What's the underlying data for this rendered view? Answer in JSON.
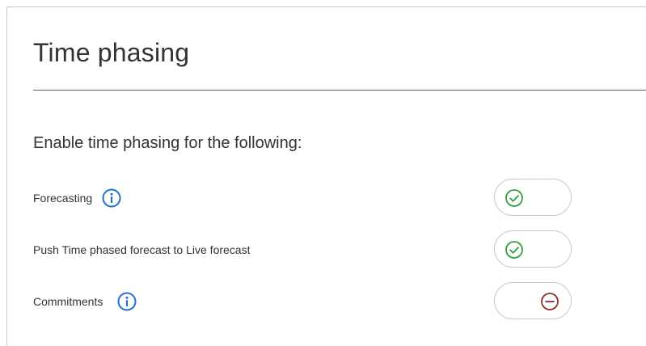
{
  "section": {
    "title": "Time phasing",
    "subtitle": "Enable time phasing for the following:"
  },
  "settings": [
    {
      "label": "Forecasting",
      "has_info": true,
      "state": "on",
      "state_icon": "check-circle-icon"
    },
    {
      "label": "Push Time phased forecast to Live forecast",
      "has_info": false,
      "state": "on",
      "state_icon": "check-circle-icon"
    },
    {
      "label": "Commitments",
      "has_info": true,
      "state": "off",
      "state_icon": "minus-circle-icon"
    }
  ],
  "colors": {
    "info_blue": "#1f6fd1",
    "on_green": "#2e9e3f",
    "off_red": "#8b2d2d",
    "divider": "#5f5f5f",
    "toggle_border": "#c9c9c9"
  },
  "icons": {
    "info": "info-icon",
    "on": "check-circle-icon",
    "off": "minus-circle-icon"
  }
}
